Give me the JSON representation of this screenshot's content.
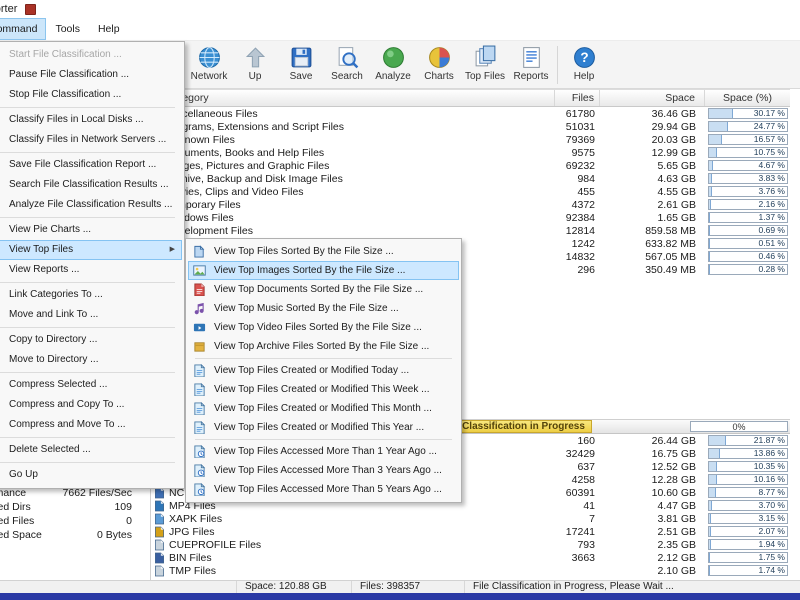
{
  "window": {
    "title": "Disk Sorter"
  },
  "menubar": {
    "items": [
      {
        "label": "Command",
        "active": true
      },
      {
        "label": "Tools"
      },
      {
        "label": "Help"
      }
    ]
  },
  "toolbar": {
    "buttons": [
      {
        "label": "Network",
        "icon": "network-icon"
      },
      {
        "label": "Up",
        "icon": "up-icon"
      },
      {
        "label": "Save",
        "icon": "save-icon"
      },
      {
        "label": "Search",
        "icon": "search-icon"
      },
      {
        "label": "Analyze",
        "icon": "analyze-icon"
      },
      {
        "label": "Charts",
        "icon": "charts-icon"
      },
      {
        "label": "Top Files",
        "icon": "top-files-icon"
      },
      {
        "label": "Reports",
        "icon": "reports-icon",
        "sep_after": true
      },
      {
        "label": "Help",
        "icon": "help-icon"
      }
    ]
  },
  "command_menu": {
    "items": [
      {
        "label": "Start File Classification ...",
        "disabled": true
      },
      {
        "label": "Pause File Classification ..."
      },
      {
        "label": "Stop File Classification ..."
      },
      {
        "separator": true
      },
      {
        "label": "Classify Files in Local Disks ..."
      },
      {
        "label": "Classify Files in Network Servers ..."
      },
      {
        "separator": true
      },
      {
        "label": "Save File Classification Report ..."
      },
      {
        "label": "Search File Classification Results ..."
      },
      {
        "label": "Analyze File Classification Results ..."
      },
      {
        "separator": true
      },
      {
        "label": "View Pie Charts ..."
      },
      {
        "label": "View Top Files",
        "highlighted": true,
        "has_submenu": true
      },
      {
        "label": "View Reports ..."
      },
      {
        "separator": true
      },
      {
        "label": "Link Categories To ..."
      },
      {
        "label": "Move and Link To ..."
      },
      {
        "separator": true
      },
      {
        "label": "Copy to Directory ..."
      },
      {
        "label": "Move to Directory ..."
      },
      {
        "separator": true
      },
      {
        "label": "Compress Selected ..."
      },
      {
        "label": "Compress and Copy To ..."
      },
      {
        "label": "Compress and Move To ..."
      },
      {
        "separator": true
      },
      {
        "label": "Delete Selected ..."
      },
      {
        "separator": true
      },
      {
        "label": "Go Up"
      }
    ]
  },
  "top_files_submenu": {
    "items": [
      {
        "label": "View Top Files Sorted By the File Size ...",
        "icon": "files-icon"
      },
      {
        "label": "View Top Images Sorted By the File Size ...",
        "icon": "image-icon",
        "highlighted": true
      },
      {
        "label": "View Top Documents Sorted By the File Size ...",
        "icon": "document-icon"
      },
      {
        "label": "View Top Music Sorted By the File Size ...",
        "icon": "music-icon"
      },
      {
        "label": "View Top Video Files Sorted By the File Size ...",
        "icon": "video-icon"
      },
      {
        "label": "View Top Archive Files Sorted By the File Size ...",
        "icon": "archive-icon"
      },
      {
        "separator": true
      },
      {
        "label": "View Top Files Created or Modified Today ...",
        "icon": "modified-icon"
      },
      {
        "label": "View Top Files Created or Modified This Week ...",
        "icon": "modified-icon"
      },
      {
        "label": "View Top Files Created or Modified This Month ...",
        "icon": "modified-icon"
      },
      {
        "label": "View Top Files Created or Modified This Year ...",
        "icon": "modified-icon"
      },
      {
        "separator": true
      },
      {
        "label": "View Top Files Accessed More Than 1 Year Ago ...",
        "icon": "accessed-icon"
      },
      {
        "label": "View Top Files Accessed More Than 3 Years Ago ...",
        "icon": "accessed-icon"
      },
      {
        "label": "View Top Files Accessed More Than 5 Years Ago ...",
        "icon": "accessed-icon"
      }
    ]
  },
  "categories_table": {
    "headers": {
      "category": "Category",
      "files": "Files",
      "space": "Space",
      "space_pct": "Space (%)"
    },
    "rows": [
      {
        "name": "Miscellaneous Files",
        "files": "61780",
        "space": "36.46 GB",
        "pct_label": "30.17 %",
        "pct_value": 30.17
      },
      {
        "name": "Programs, Extensions and Script Files",
        "files": "51031",
        "space": "29.94 GB",
        "pct_label": "24.77 %",
        "pct_value": 24.77
      },
      {
        "name": "Unknown Files",
        "files": "79369",
        "space": "20.03 GB",
        "pct_label": "16.57 %",
        "pct_value": 16.57
      },
      {
        "name": "Documents, Books and Help Files",
        "files": "9575",
        "space": "12.99 GB",
        "pct_label": "10.75 %",
        "pct_value": 10.75
      },
      {
        "name": "Images, Pictures and Graphic Files",
        "files": "69232",
        "space": "5.65 GB",
        "pct_label": "4.67 %",
        "pct_value": 4.67
      },
      {
        "name": "Archive, Backup and Disk Image Files",
        "files": "984",
        "space": "4.63 GB",
        "pct_label": "3.83 %",
        "pct_value": 3.83
      },
      {
        "name": "Movies, Clips and Video Files",
        "files": "455",
        "space": "4.55 GB",
        "pct_label": "3.76 %",
        "pct_value": 3.76
      },
      {
        "name": "Temporary Files",
        "files": "4372",
        "space": "2.61 GB",
        "pct_label": "2.16 %",
        "pct_value": 2.16
      },
      {
        "name": "Windows Files",
        "files": "92384",
        "space": "1.65 GB",
        "pct_label": "1.37 %",
        "pct_value": 1.37
      },
      {
        "name": "Development Files",
        "files": "12814",
        "space": "859.58 MB",
        "pct_label": "0.69 %",
        "pct_value": 0.69
      },
      {
        "name": "",
        "files": "1242",
        "space": "633.82 MB",
        "pct_label": "0.51 %",
        "pct_value": 0.51
      },
      {
        "name": "",
        "files": "14832",
        "space": "567.05 MB",
        "pct_label": "0.46 %",
        "pct_value": 0.46
      },
      {
        "name": "",
        "files": "296",
        "space": "350.49 MB",
        "pct_label": "0.28 %",
        "pct_value": 0.28
      }
    ]
  },
  "progress_bar": {
    "label": "Classification in Progress",
    "percent_label": "0%",
    "percent_value": 0
  },
  "extensions_table": {
    "rows": [
      {
        "name": "",
        "files": "160",
        "space": "26.44 GB",
        "pct_label": "21.87 %",
        "pct_value": 21.87,
        "icon_color": "#6fa8dc"
      },
      {
        "name": "",
        "files": "32429",
        "space": "16.75 GB",
        "pct_label": "13.86 %",
        "pct_value": 13.86,
        "icon_color": "#6fa8dc"
      },
      {
        "name": "",
        "files": "637",
        "space": "12.52 GB",
        "pct_label": "10.35 %",
        "pct_value": 10.35,
        "icon_color": "#6fa8dc"
      },
      {
        "name": "",
        "files": "4258",
        "space": "12.28 GB",
        "pct_label": "10.16 %",
        "pct_value": 10.16,
        "icon_color": "#6fa8dc"
      },
      {
        "name": "NC",
        "files": "60391",
        "space": "10.60 GB",
        "pct_label": "8.77 %",
        "pct_value": 8.77,
        "icon_color": "#3f6fb5"
      },
      {
        "name": "MP4 Files",
        "files": "41",
        "space": "4.47 GB",
        "pct_label": "3.70 %",
        "pct_value": 3.7,
        "icon_color": "#2e75b6"
      },
      {
        "name": "XAPK Files",
        "files": "7",
        "space": "3.81 GB",
        "pct_label": "3.15 %",
        "pct_value": 3.15,
        "icon_color": "#5b9bd5"
      },
      {
        "name": "JPG Files",
        "files": "17241",
        "space": "2.51 GB",
        "pct_label": "2.07 %",
        "pct_value": 2.07,
        "icon_color": "#d4a017"
      },
      {
        "name": "CUEPROFILE Files",
        "files": "793",
        "space": "2.35 GB",
        "pct_label": "1.94 %",
        "pct_value": 1.94,
        "icon_color": "#c9d4dd"
      },
      {
        "name": "BIN Files",
        "files": "3663",
        "space": "2.12 GB",
        "pct_label": "1.75 %",
        "pct_value": 1.75,
        "icon_color": "#3a5fa0"
      },
      {
        "name": "TMP Files",
        "files": "",
        "space": "2.10 GB",
        "pct_label": "1.74 %",
        "pct_value": 1.74,
        "icon_color": "#c9d4dd"
      }
    ]
  },
  "stats_panel": {
    "rows": [
      {
        "label": "Performance",
        "value": "7662 Files/Sec"
      },
      {
        "label": "Excluded Dirs",
        "value": "109"
      },
      {
        "label": "Excluded Files",
        "value": "0"
      },
      {
        "label": "Excluded Space",
        "value": "0 Bytes"
      }
    ]
  },
  "status_bar": {
    "space": "Space: 120.88 GB",
    "files": "Files: 398357",
    "message": "File Classification in Progress, Please Wait ..."
  },
  "colors": {
    "menu_highlight": "#cde8ff",
    "percent_fill": "#c9def2",
    "banner_yellow": "#edce45",
    "taskbar_blue": "#2b3aa5"
  }
}
